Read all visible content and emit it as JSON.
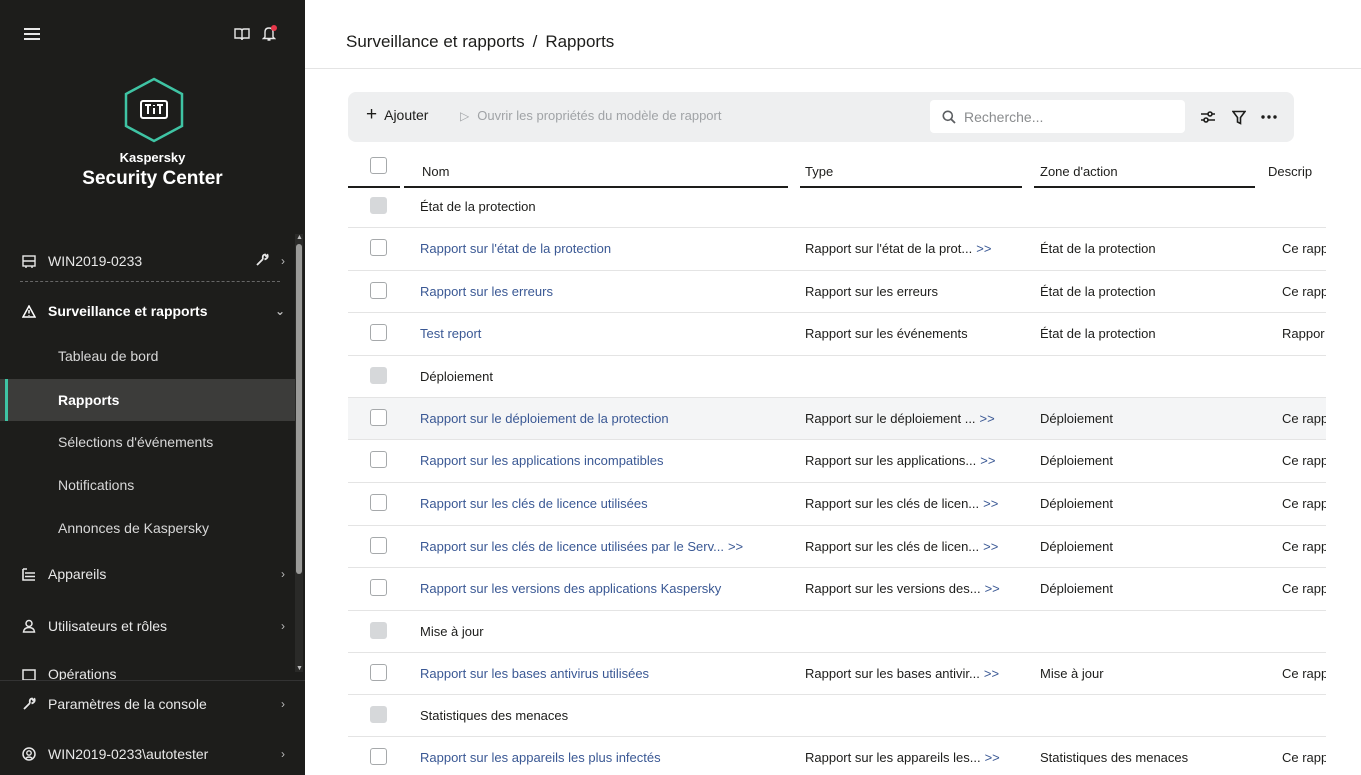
{
  "sidebar": {
    "brand_small": "Kaspersky",
    "brand_large": "Security Center",
    "server": "WIN2019-0233",
    "items": [
      {
        "label": "Surveillance et rapports"
      },
      {
        "label": "Tableau de bord"
      },
      {
        "label": "Rapports"
      },
      {
        "label": "Sélections d'événements"
      },
      {
        "label": "Notifications"
      },
      {
        "label": "Annonces de Kaspersky"
      },
      {
        "label": "Appareils"
      },
      {
        "label": "Utilisateurs et rôles"
      },
      {
        "label": "Opérations"
      }
    ],
    "console_settings": "Paramètres de la console",
    "user": "WIN2019-0233\\autotester"
  },
  "breadcrumb": {
    "parent": "Surveillance et rapports",
    "separator": "/",
    "current": "Rapports"
  },
  "toolbar": {
    "add_label": "Ajouter",
    "open_props_label": "Ouvrir les propriétés du modèle de rapport",
    "search_placeholder": "Recherche..."
  },
  "table": {
    "columns": [
      "Nom",
      "Type",
      "Zone d'action",
      "Descrip"
    ],
    "groups": [
      {
        "name": "État de la protection",
        "rows": [
          {
            "name": "Rapport sur l'état de la protection",
            "type": "Rapport sur l'état de la prot...",
            "zone": "État de la protection",
            "desc": "Ce rapp"
          },
          {
            "name": "Rapport sur les erreurs",
            "type": "Rapport sur les erreurs",
            "zone": "État de la protection",
            "desc": "Ce rapp"
          },
          {
            "name": "Test report",
            "type": "Rapport sur les événements",
            "zone": "État de la protection",
            "desc": "Rappor"
          }
        ]
      },
      {
        "name": "Déploiement",
        "rows": [
          {
            "name": "Rapport sur le déploiement de la protection",
            "type": "Rapport sur le déploiement ...",
            "zone": "Déploiement",
            "desc": "Ce rapp"
          },
          {
            "name": "Rapport sur les applications incompatibles",
            "type": "Rapport sur les applications...",
            "zone": "Déploiement",
            "desc": "Ce rapp"
          },
          {
            "name": "Rapport sur les clés de licence utilisées",
            "type": "Rapport sur les clés de licen...",
            "zone": "Déploiement",
            "desc": "Ce rapp"
          },
          {
            "name": "Rapport sur les clés de licence utilisées par le Serv...",
            "type": "Rapport sur les clés de licen...",
            "zone": "Déploiement",
            "desc": "Ce rapp"
          },
          {
            "name": "Rapport sur les versions des applications Kaspersky",
            "type": "Rapport sur les versions des...",
            "zone": "Déploiement",
            "desc": "Ce rapp"
          }
        ]
      },
      {
        "name": "Mise à jour",
        "rows": [
          {
            "name": "Rapport sur les bases antivirus utilisées",
            "type": "Rapport sur les bases antivir...",
            "zone": "Mise à jour",
            "desc": "Ce rapp"
          }
        ]
      },
      {
        "name": "Statistiques des menaces",
        "rows": [
          {
            "name": "Rapport sur les appareils les plus infectés",
            "type": "Rapport sur les appareils les...",
            "zone": "Statistiques des menaces",
            "desc": "Ce rapp"
          }
        ]
      }
    ],
    "expand_glyph": ">>"
  },
  "colors": {
    "sidebar_bg": "#1d1d1b",
    "accent": "#3fc4a4",
    "link": "#3a5894",
    "notification": "#e8374a"
  },
  "icons": [
    "menu-icon",
    "book-icon",
    "bell-icon",
    "kaspersky-logo",
    "server-icon",
    "wrench-icon",
    "warning-icon",
    "devices-icon",
    "users-icon",
    "operations-icon",
    "user-circle-icon",
    "search-icon",
    "sliders-icon",
    "filter-icon",
    "more-icon"
  ]
}
